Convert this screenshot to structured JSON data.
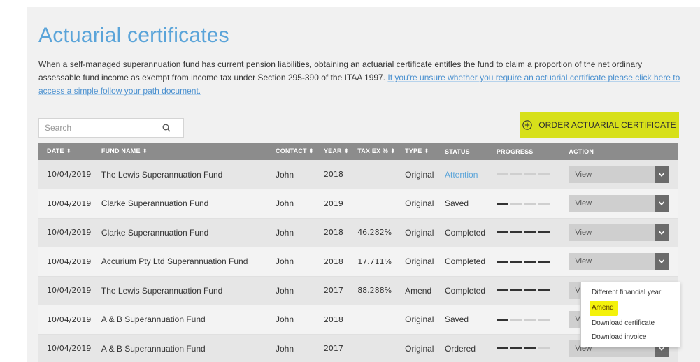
{
  "page": {
    "title": "Actuarial certificates",
    "intro_text": "When a self-managed superannuation fund has current pension liabilities, obtaining an actuarial certificate entitles the fund to claim a proportion of the net ordinary assessable fund income as exempt from income tax under Section 295-390 of the ITAA 1997. ",
    "intro_link": "If you're unsure whether you require an actuarial certificate please click here to access a simple follow your path document."
  },
  "search": {
    "placeholder": "Search"
  },
  "order_button": {
    "label": "ORDER ACTUARIAL CERTIFICATE",
    "color": "#d7e01a"
  },
  "table": {
    "headers": {
      "date": "DATE ⬍",
      "fund": "FUND NAME ⬍",
      "contact": "CONTACT ⬍",
      "year": "YEAR ⬍",
      "tax": "TAX EX % ⬍",
      "type": "TYPE ⬍",
      "status": "STATUS",
      "progress": "PROGRESS",
      "action": "ACTION"
    },
    "rows": [
      {
        "date": "10/04/2019",
        "fund": "The Lewis Superannuation Fund",
        "contact": "John",
        "year": "2018",
        "tax": "",
        "type": "Original",
        "status": "Attention",
        "progress": 0,
        "action": "View"
      },
      {
        "date": "10/04/2019",
        "fund": "Clarke Superannuation Fund",
        "contact": "John",
        "year": "2019",
        "tax": "",
        "type": "Original",
        "status": "Saved",
        "progress": 1,
        "action": "View"
      },
      {
        "date": "10/04/2019",
        "fund": "Clarke Superannuation Fund",
        "contact": "John",
        "year": "2018",
        "tax": "46.282%",
        "type": "Original",
        "status": "Completed",
        "progress": 4,
        "action": "View"
      },
      {
        "date": "10/04/2019",
        "fund": "Accurium Pty Ltd Superannuation Fund",
        "contact": "John",
        "year": "2018",
        "tax": "17.711%",
        "type": "Original",
        "status": "Completed",
        "progress": 4,
        "action": "View"
      },
      {
        "date": "10/04/2019",
        "fund": "The Lewis Superannuation Fund",
        "contact": "John",
        "year": "2017",
        "tax": "88.288%",
        "type": "Amend",
        "status": "Completed",
        "progress": 4,
        "action": "View"
      },
      {
        "date": "10/04/2019",
        "fund": "A & B Superannuation Fund",
        "contact": "John",
        "year": "2018",
        "tax": "",
        "type": "Original",
        "status": "Saved",
        "progress": 1,
        "action": "View"
      },
      {
        "date": "10/04/2019",
        "fund": "A & B Superannuation Fund",
        "contact": "John",
        "year": "2017",
        "tax": "",
        "type": "Original",
        "status": "Ordered",
        "progress": 3,
        "action": "View"
      }
    ]
  },
  "dropdown": {
    "items": [
      "Different financial year",
      "Amend",
      "Download certificate",
      "Download invoice"
    ],
    "highlight_color": "#f4f20b"
  },
  "colors": {
    "title": "#5aa4d9",
    "header_bg": "#8c8c8c",
    "attention": "#5aa4d9"
  }
}
